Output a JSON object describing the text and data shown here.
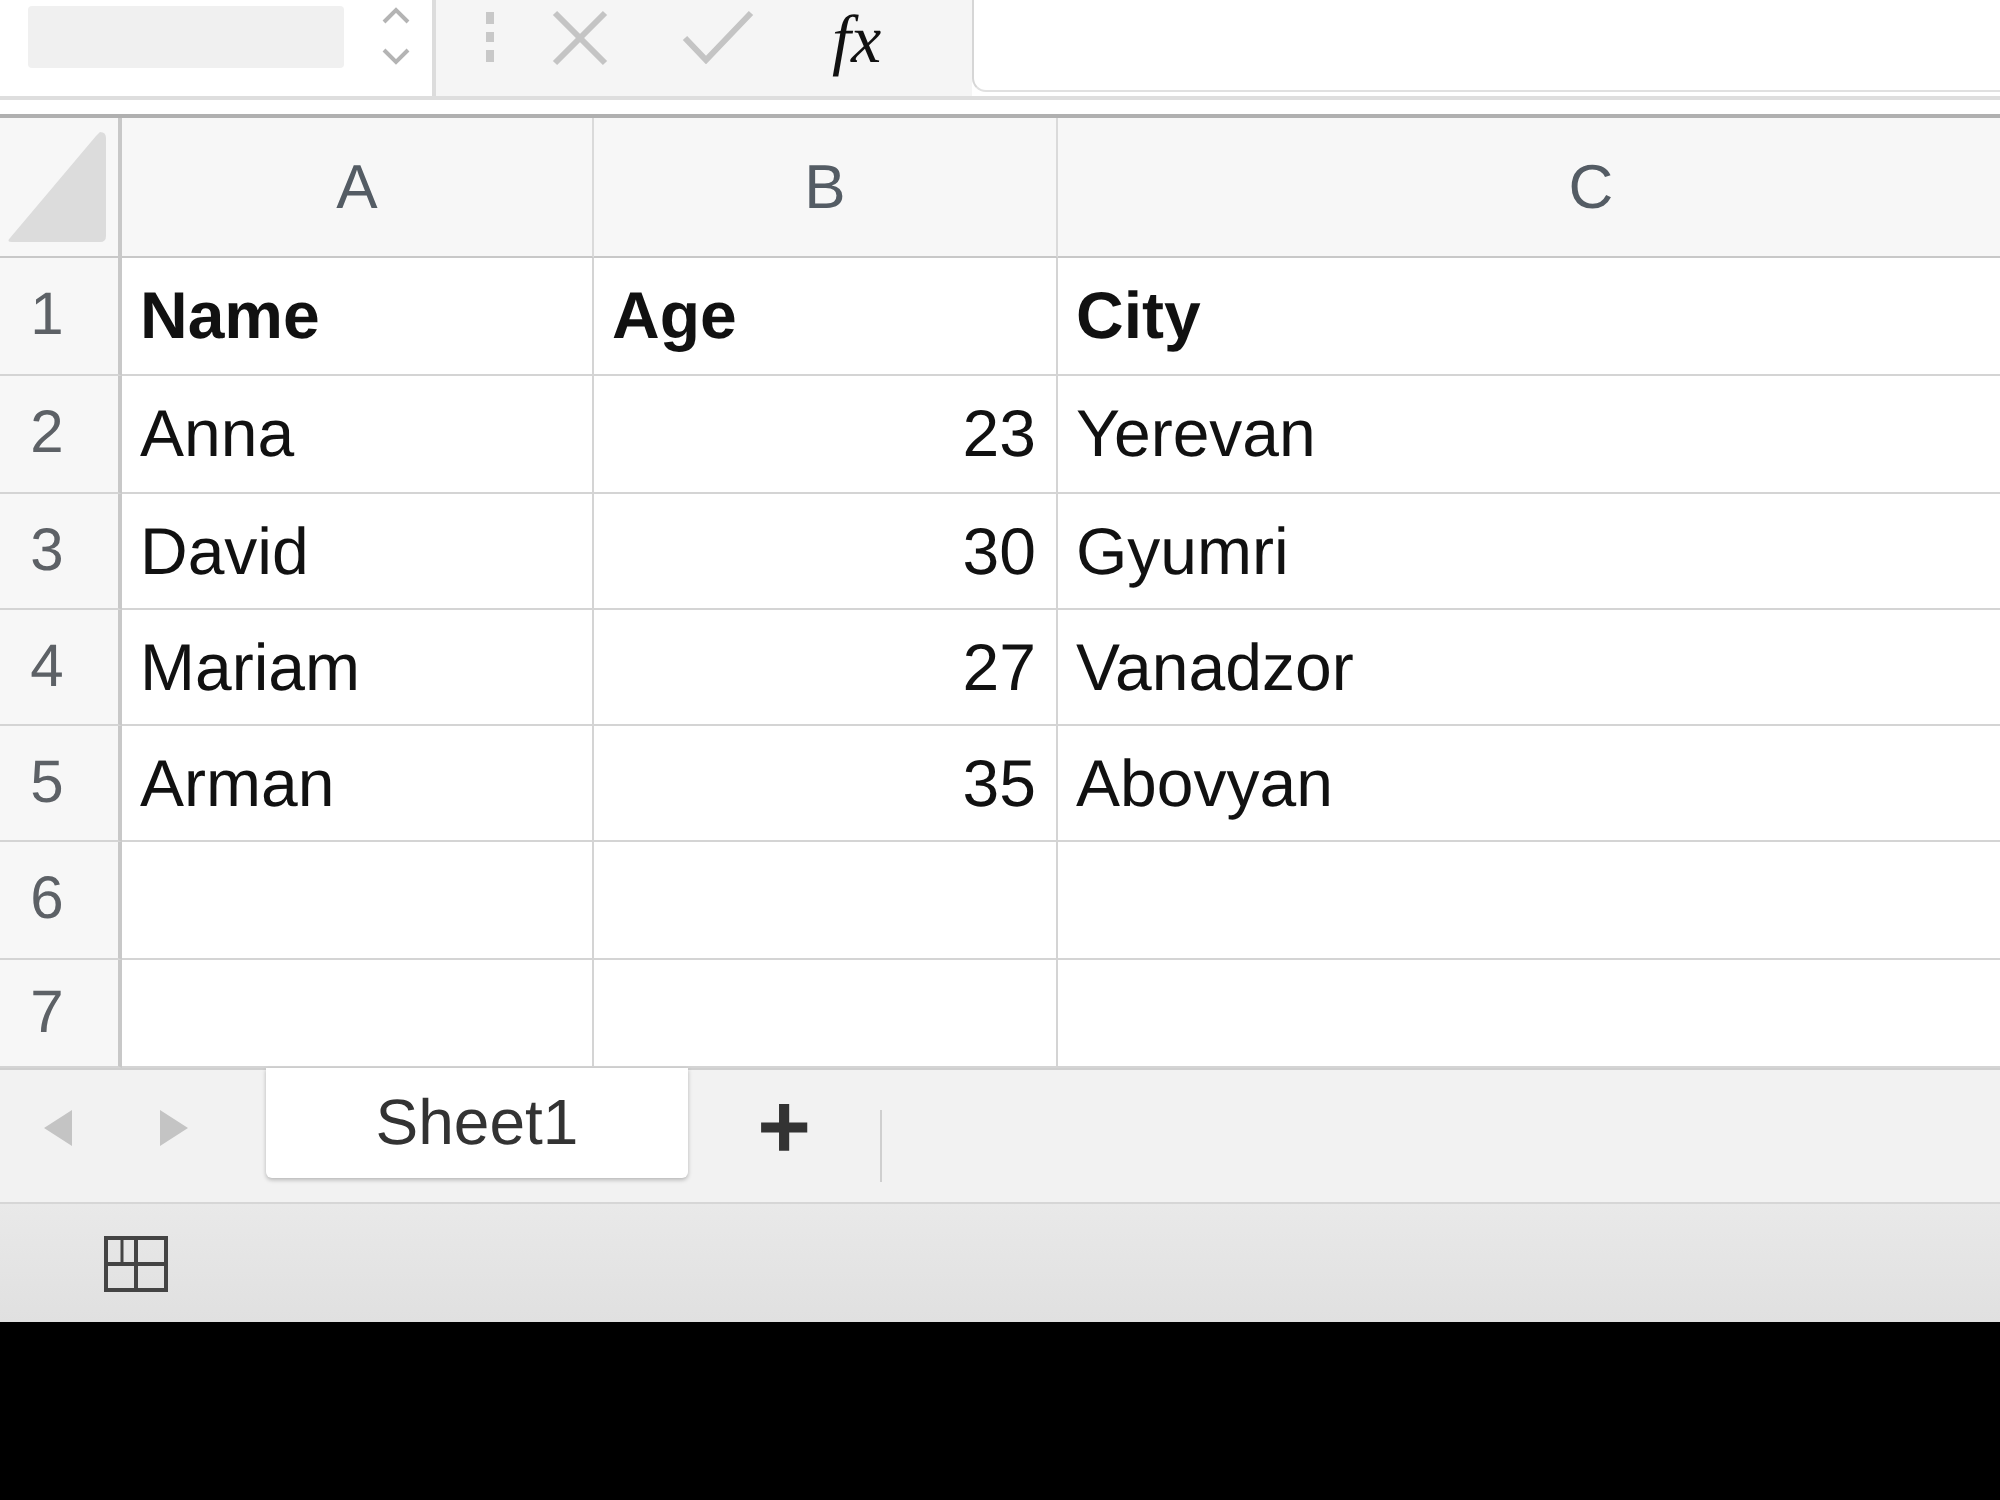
{
  "formula_bar": {
    "function_label": "fx"
  },
  "columns": [
    {
      "label": "A"
    },
    {
      "label": "B"
    },
    {
      "label": "C"
    }
  ],
  "rows": [
    {
      "number": "1",
      "cells": [
        {
          "text": "Name",
          "kind": "text",
          "bold": true
        },
        {
          "text": "Age",
          "kind": "text",
          "bold": true
        },
        {
          "text": "City",
          "kind": "text",
          "bold": true
        }
      ]
    },
    {
      "number": "2",
      "cells": [
        {
          "text": "Anna",
          "kind": "text",
          "bold": false
        },
        {
          "text": "23",
          "kind": "number",
          "bold": false
        },
        {
          "text": "Yerevan",
          "kind": "text",
          "bold": false
        }
      ]
    },
    {
      "number": "3",
      "cells": [
        {
          "text": "David",
          "kind": "text",
          "bold": false
        },
        {
          "text": "30",
          "kind": "number",
          "bold": false
        },
        {
          "text": "Gyumri",
          "kind": "text",
          "bold": false
        }
      ]
    },
    {
      "number": "4",
      "cells": [
        {
          "text": "Mariam",
          "kind": "text",
          "bold": false
        },
        {
          "text": "27",
          "kind": "number",
          "bold": false
        },
        {
          "text": "Vanadzor",
          "kind": "text",
          "bold": false
        }
      ]
    },
    {
      "number": "5",
      "cells": [
        {
          "text": "Arman",
          "kind": "text",
          "bold": false
        },
        {
          "text": "35",
          "kind": "number",
          "bold": false
        },
        {
          "text": "Abovyan",
          "kind": "text",
          "bold": false
        }
      ]
    },
    {
      "number": "6"
    },
    {
      "number": "7"
    }
  ],
  "sheet_tabs": [
    {
      "label": "Sheet1",
      "selected": true
    }
  ],
  "add_sheet_label": "+"
}
